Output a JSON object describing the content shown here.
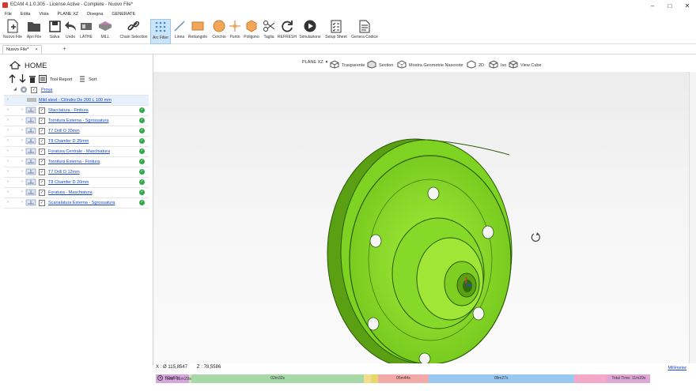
{
  "window": {
    "title": "ECAM 4.1.0.305 - License Active - Complete - Nuovo File*"
  },
  "menu": [
    "File",
    "Edita",
    "Vista",
    "PLANE XZ",
    "Disegna",
    "GENERATE"
  ],
  "toolbar": {
    "items": [
      {
        "label": "Nuovo File",
        "icon": "new-file-icon"
      },
      {
        "label": "Apri File",
        "icon": "folder-icon"
      },
      {
        "label": "Salva",
        "icon": "save-icon"
      },
      {
        "label": "Undo",
        "icon": "undo-icon"
      },
      {
        "label": "LATHE",
        "icon": "lathe-icon"
      },
      {
        "label": "MILL",
        "icon": "mill-icon"
      },
      {
        "label": "Chain Selection",
        "icon": "chain-icon"
      },
      {
        "label": "Arc Filter",
        "icon": "grid-icon"
      },
      {
        "label": "Linea",
        "icon": "line-icon"
      },
      {
        "label": "Rettangolo",
        "icon": "rectangle-icon"
      },
      {
        "label": "Cerchio",
        "icon": "circle-icon"
      },
      {
        "label": "Punto",
        "icon": "point-icon"
      },
      {
        "label": "Poligono",
        "icon": "polygon-icon"
      },
      {
        "label": "Taglia",
        "icon": "scissors-icon"
      },
      {
        "label": "REFRESH",
        "icon": "refresh-icon"
      },
      {
        "label": "Simulazione",
        "icon": "play-icon"
      },
      {
        "label": "Setup Sheet",
        "icon": "checklist-icon"
      },
      {
        "label": "Genera Codice",
        "icon": "document-icon"
      }
    ]
  },
  "tabs": {
    "doc": "Nuovo File*",
    "plus": "+"
  },
  "panel": {
    "home": "HOME",
    "tool_report": "Tool Report",
    "sort": "Sort",
    "root": "Prova",
    "stock": "Mild steel - Cilindro De 200 L 100 mm",
    "operations": [
      "Sfacciatura - Finitura",
      "Tornitura Esterna - Sgrossatura",
      "T7 Drill  D 20mm",
      "T8 Chamfer D 25mm",
      "Foratura Centrale - Maschiatura",
      "Tornitura Esterna - Finitura",
      "T7 Drill  D 12mm",
      "T8 Chamfer D 20mm",
      "Foratura - Maschiatura",
      "Scanalatura Esterna - Sgrossatura"
    ]
  },
  "viewbar": {
    "plane": "PLANE XZ",
    "transparent": "Trasparente",
    "section": "Section",
    "hidden": "Mostra Geometrie Nascoste",
    "v2d": "2D",
    "iso": "Iso",
    "cube": "View Cube"
  },
  "status": {
    "x": "X : Ø 115,8547",
    "z": "Z : 78,5586",
    "units": "Millimeter",
    "total": "Total: 11m29s"
  },
  "timeline": [
    {
      "label": "00m50s",
      "color": "#d8a6df",
      "fraction": 0.062
    },
    {
      "label": "",
      "color": "#cfe9b4",
      "fraction": 0.005
    },
    {
      "label": "02m32s",
      "color": "#a7d8a8",
      "fraction": 0.322
    },
    {
      "label": "",
      "color": "#f1df8b",
      "fraction": 0.014
    },
    {
      "label": "",
      "color": "#e6d86d",
      "fraction": 0.013
    },
    {
      "label": "05m44s",
      "color": "#f3a9a8",
      "fraction": 0.094
    },
    {
      "label": "08m27s",
      "color": "#9bc8f0",
      "fraction": 0.272
    },
    {
      "label": "",
      "color": "#f3a9c7",
      "fraction": 0.062
    },
    {
      "label": "Total Time: 11m29s",
      "color": "#dda7d6",
      "fraction": 0.081
    }
  ],
  "colors": {
    "part": "#8fe02a",
    "accent": "#1a47c8",
    "ok": "#2fa94a"
  }
}
